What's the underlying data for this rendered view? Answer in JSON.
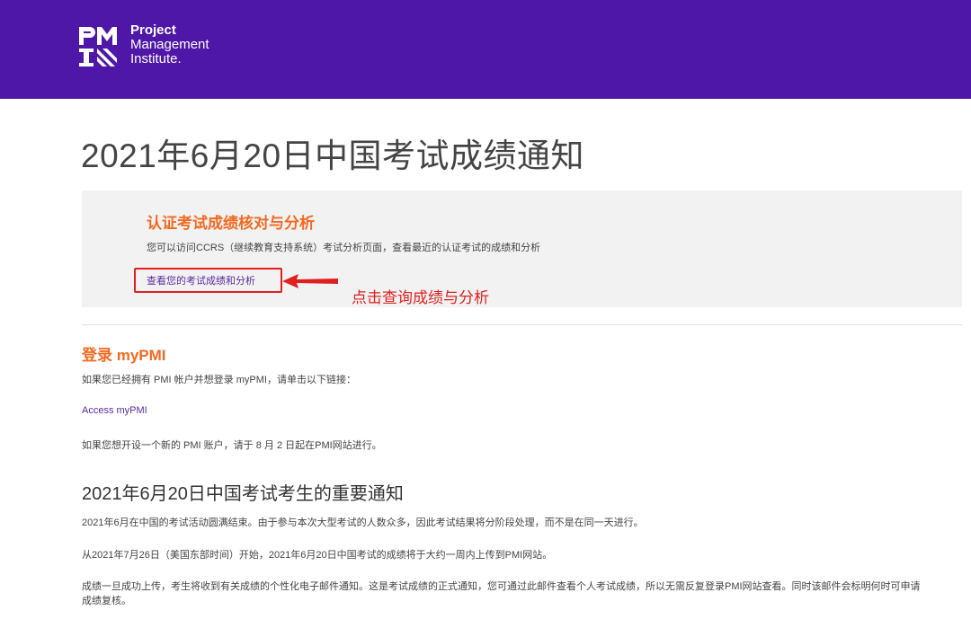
{
  "header": {
    "logo_letters": "PMI",
    "logo_line1": "Project",
    "logo_line2": "Management",
    "logo_line3": "Institute."
  },
  "page_title": "2021年6月20日中国考试成绩通知",
  "panel": {
    "heading": "认证考试成绩核对与分析",
    "description": "您可以访问CCRS（继续教育支持系统）考试分析页面，查看最近的认证考试的成绩和分析",
    "link_label": "查看您的考试成绩和分析",
    "annotation": "点击查询成绩与分析"
  },
  "login": {
    "title": "登录 myPMI",
    "instruction": "如果您已经拥有 PMI 帐户并想登录 myPMI，请单击以下链接：",
    "link_label": "Access myPMI",
    "new_account": "如果您想开设一个新的 PMI 账户，请于 8 月 2 日起在PMI网站进行。"
  },
  "notice": {
    "title": "2021年6月20日中国考试考生的重要通知",
    "p1": "2021年6月在中国的考试活动圆满结束。由于参与本次大型考试的人数众多，因此考试结果将分阶段处理，而不是在同一天进行。",
    "p2": "从2021年7月26日（美国东部时间）开始，2021年6月20日中国考试的成绩将于大约一周内上传到PMI网站。",
    "p3": "成绩一旦成功上传，考生将收到有关成绩的个性化电子邮件通知。这是考试成绩的正式通知，您可通过此邮件查看个人考试成绩，所以无需反复登录PMI网站查看。同时该邮件会标明何时可申请成绩复核。"
  },
  "colors": {
    "header_bg": "#4f17a8",
    "accent_orange": "#f26a21",
    "link_purple": "#5a2aa0",
    "annotation_red": "#e02020"
  }
}
